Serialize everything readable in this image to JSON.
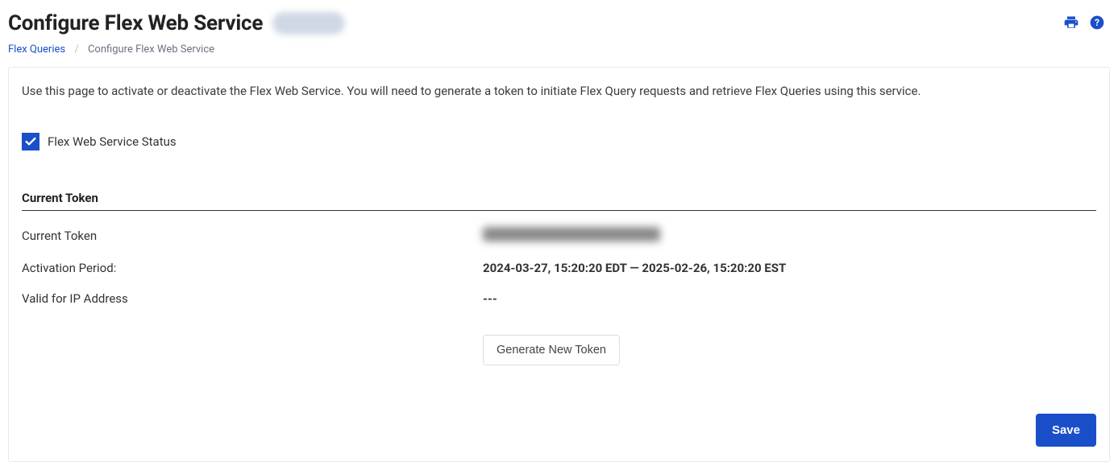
{
  "header": {
    "title": "Configure Flex Web Service"
  },
  "breadcrumbs": {
    "parent": "Flex Queries",
    "current": "Configure Flex Web Service"
  },
  "panel": {
    "instructions": "Use this page to activate or deactivate the Flex Web Service. You will need to generate a token to initiate Flex Query requests and retrieve Flex Queries using this service.",
    "status_label": "Flex Web Service Status",
    "status_checked": true,
    "section_heading": "Current Token",
    "rows": {
      "current_token_label": "Current Token",
      "activation_period_label": "Activation Period:",
      "activation_period_value": "2024-03-27, 15:20:20 EDT — 2025-02-26, 15:20:20 EST",
      "valid_ip_label": "Valid for IP Address",
      "valid_ip_value": "---"
    },
    "generate_button": "Generate New Token",
    "save_button": "Save"
  }
}
